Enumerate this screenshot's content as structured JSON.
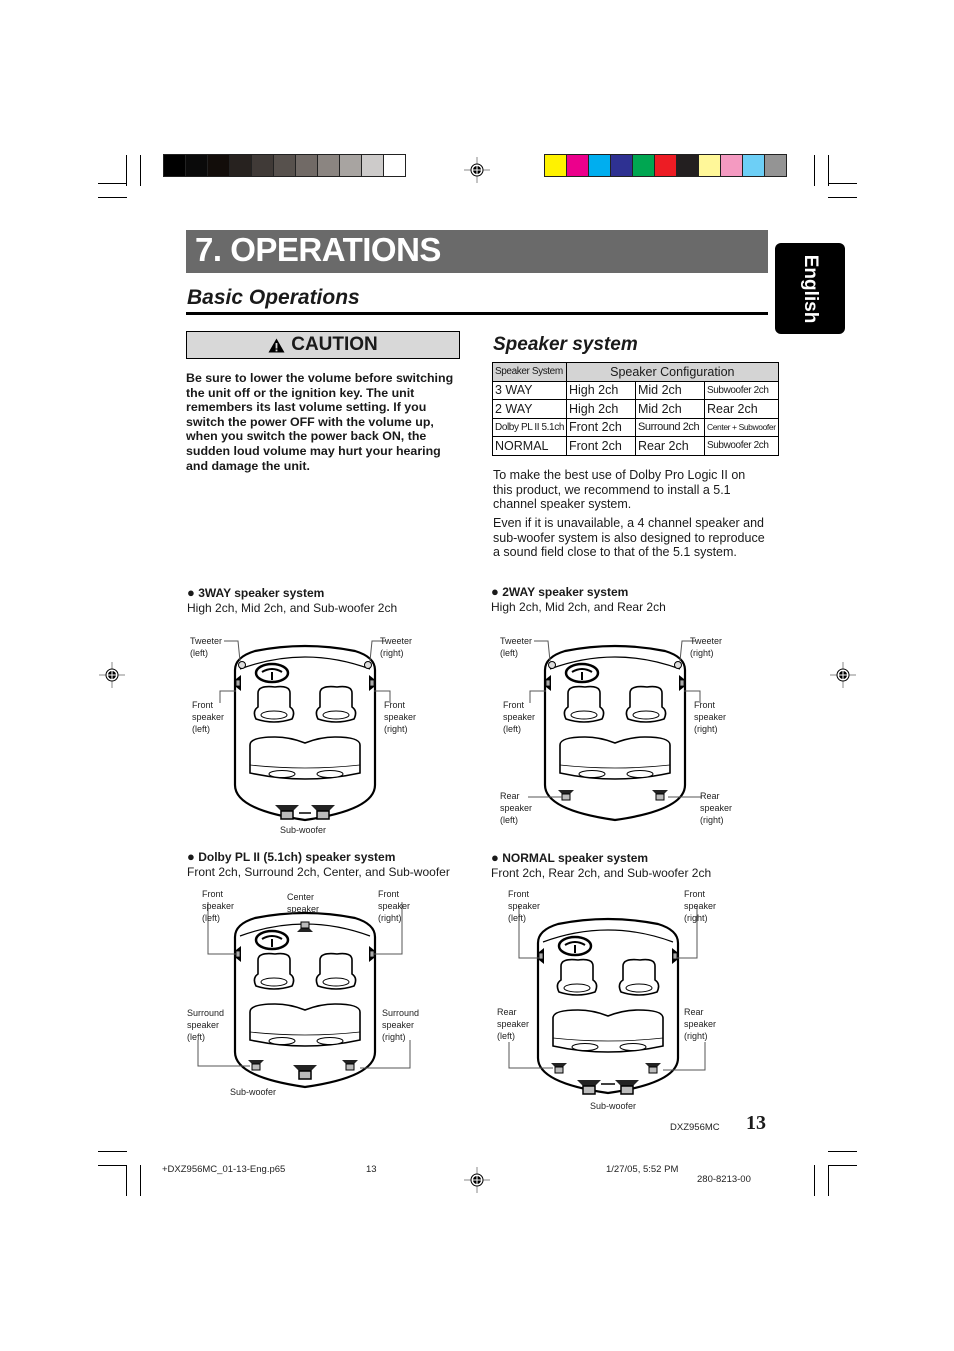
{
  "print_marks": {
    "grayscale_swatches": [
      "#000000",
      "#0a0a0a",
      "#120d0a",
      "#27221f",
      "#403a37",
      "#57514d",
      "#716a66",
      "#8b8581",
      "#a8a4a1",
      "#cdcbca",
      "#ffffff"
    ],
    "color_swatches": [
      "#fff200",
      "#ec008c",
      "#00aeef",
      "#2e3192",
      "#00a651",
      "#ed1c24",
      "#231f20",
      "#fff799",
      "#f49ac1",
      "#6dcff6",
      "#949494"
    ]
  },
  "header": {
    "title": "7. OPERATIONS",
    "subtitle": "Basic Operations",
    "language_tab": "English"
  },
  "caution": {
    "label": "CAUTION",
    "icon": "warning-triangle-icon",
    "text": "Be sure to lower the volume before switching the unit off or the ignition key. The unit remembers its last volume setting. If you switch the power OFF with the volume up, when you switch the power back ON, the sudden loud volume may hurt your hearing and damage the unit."
  },
  "speaker_system": {
    "title": "Speaker system",
    "table": {
      "headers": [
        "Speaker System",
        "Speaker Configuration"
      ],
      "rows": [
        [
          "3 WAY",
          "High 2ch",
          "Mid 2ch",
          "Subwoofer 2ch"
        ],
        [
          "2 WAY",
          "High 2ch",
          "Mid 2ch",
          "Rear 2ch"
        ],
        [
          "Dolby PL II 5.1ch",
          "Front 2ch",
          "Surround 2ch",
          "Center + Subwoofer"
        ],
        [
          "NORMAL",
          "Front 2ch",
          "Rear 2ch",
          "Subwoofer 2ch"
        ]
      ]
    },
    "paragraphs": [
      "To make the best use of Dolby Pro Logic II on this product, we recommend to install a 5.1 channel speaker system.",
      "Even if it is unavailable, a 4 channel speaker and sub-woofer system is also designed to reproduce a sound field close to that of the 5.1 system."
    ]
  },
  "diagrams": [
    {
      "bullet": "●",
      "title": "3WAY speaker system",
      "description": "High 2ch, Mid 2ch, and Sub-woofer 2ch",
      "labels": {
        "tweeter_left": [
          "Tweeter",
          "(left)"
        ],
        "tweeter_right": [
          "Tweeter",
          "(right)"
        ],
        "front_left": [
          "Front",
          "speaker",
          "(left)"
        ],
        "front_right": [
          "Front",
          "speaker",
          "(right)"
        ],
        "subwoofer": [
          "Sub-woofer"
        ]
      }
    },
    {
      "bullet": "●",
      "title": "2WAY speaker system",
      "description": "High 2ch, Mid 2ch, and Rear 2ch",
      "labels": {
        "tweeter_left": [
          "Tweeter",
          "(left)"
        ],
        "tweeter_right": [
          "Tweeter",
          "(right)"
        ],
        "front_left": [
          "Front",
          "speaker",
          "(left)"
        ],
        "front_right": [
          "Front",
          "speaker",
          "(right)"
        ],
        "rear_left": [
          "Rear",
          "speaker",
          "(left)"
        ],
        "rear_right": [
          "Rear",
          "speaker",
          "(right)"
        ]
      }
    },
    {
      "bullet": "●",
      "title": "Dolby PL II (5.1ch) speaker system",
      "description": "Front 2ch, Surround 2ch, Center, and Sub-woofer",
      "labels": {
        "front_left": [
          "Front",
          "speaker",
          "(left)"
        ],
        "center": [
          "Center",
          "speaker"
        ],
        "front_right": [
          "Front",
          "speaker",
          "(right)"
        ],
        "surround_left": [
          "Surround",
          "speaker",
          "(left)"
        ],
        "surround_right": [
          "Surround",
          "speaker",
          "(right)"
        ],
        "subwoofer": [
          "Sub-woofer"
        ]
      }
    },
    {
      "bullet": "●",
      "title": "NORMAL speaker system",
      "description": "Front 2ch, Rear 2ch, and Sub-woofer 2ch",
      "labels": {
        "front_left": [
          "Front",
          "speaker",
          "(left)"
        ],
        "front_right": [
          "Front",
          "speaker",
          "(right)"
        ],
        "rear_left": [
          "Rear",
          "speaker",
          "(left)"
        ],
        "rear_right": [
          "Rear",
          "speaker",
          "(right)"
        ],
        "subwoofer": [
          "Sub-woofer"
        ]
      }
    }
  ],
  "footer": {
    "model": "DXZ956MC",
    "page_number": "13",
    "file_name": "+DXZ956MC_01-13-Eng.p65",
    "file_page": "13",
    "timestamp": "1/27/05, 5:52 PM",
    "part_number": "280-8213-00"
  }
}
